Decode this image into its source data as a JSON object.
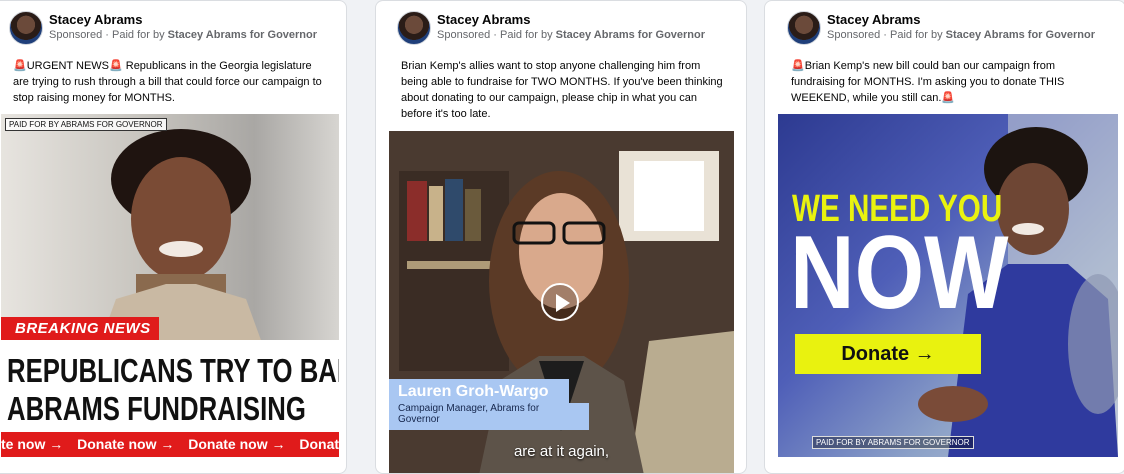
{
  "cards": [
    {
      "page_name": "Stacey Abrams",
      "sponsored": "Sponsored",
      "paid_prefix": "Paid for by",
      "paid_by": "Stacey Abrams for Governor",
      "body_text": "🚨URGENT NEWS🚨 Republicans in the Georgia legislature are trying to rush through a bill that could force our campaign to stop raising money for MONTHS.",
      "paid_tag": "PAID FOR BY ABRAMS FOR GOVERNOR",
      "breaking": "BREAKING NEWS",
      "headline_1": "REPUBLICANS TRY TO BAN",
      "headline_2": "ABRAMS FUNDRAISING",
      "ticker": [
        "te now →",
        "Donate now →",
        "Donate now →",
        "Donate now"
      ]
    },
    {
      "page_name": "Stacey Abrams",
      "sponsored": "Sponsored",
      "paid_prefix": "Paid for by",
      "paid_by": "Stacey Abrams for Governor",
      "body_text": "Brian Kemp's allies want to stop anyone challenging him from being able to fundraise for TWO MONTHS. If you've been thinking about donating to our campaign, please chip in what you can before it's too late.",
      "lower_third_name": "Lauren Groh-Wargo",
      "lower_third_role": "Campaign Manager, Abrams for Governor",
      "caption": "are at it again,"
    },
    {
      "page_name": "Stacey Abrams",
      "sponsored": "Sponsored",
      "paid_prefix": "Paid for by",
      "paid_by": "Stacey Abrams for Governor",
      "body_text": "🚨Brian Kemp's new bill could ban our campaign from fundraising for MONTHS. I'm asking you to donate THIS WEEKEND, while you still can.🚨",
      "headline_1": "WE NEED YOU",
      "headline_2": "NOW",
      "donate_label": "Donate →",
      "paid_tag": "PAID FOR BY ABRAMS FOR GOVERNOR"
    }
  ],
  "colors": {
    "red": "#e01b1b",
    "yellow": "#e9f20f",
    "blue_bg": "#2d3a91",
    "lower_third": "#a9c7f2"
  }
}
